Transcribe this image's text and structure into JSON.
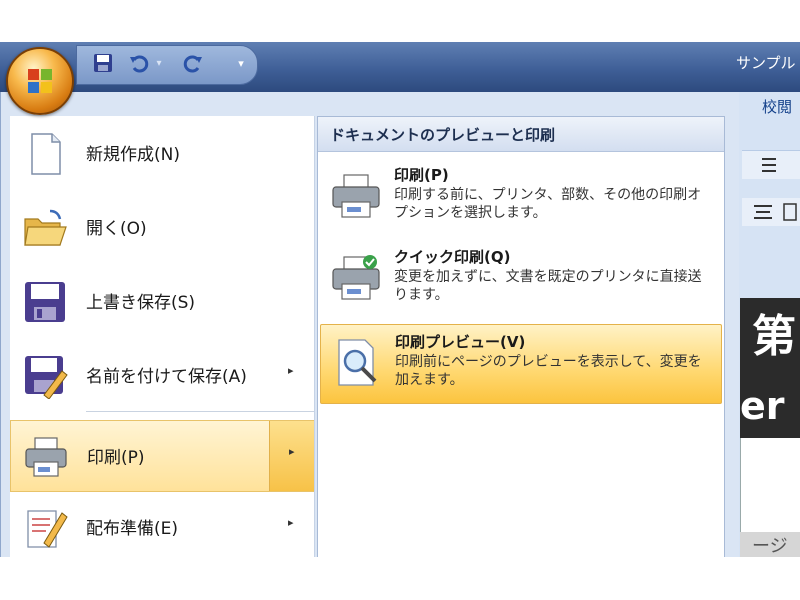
{
  "title_bar": {
    "title": "サンプル"
  },
  "ribbon": {
    "tab_partial": "校閲"
  },
  "document": {
    "heading_partial": "第",
    "latin_partial": "er",
    "bottom_partial": "ージ"
  },
  "menu": {
    "items": [
      {
        "label": "新規作成(N)",
        "icon": "new-document-icon",
        "has_submenu": false
      },
      {
        "label": "開く(O)",
        "icon": "open-folder-icon",
        "has_submenu": false
      },
      {
        "label": "上書き保存(S)",
        "icon": "save-icon",
        "has_submenu": false
      },
      {
        "label": "名前を付けて保存(A)",
        "icon": "save-as-icon",
        "has_submenu": true
      },
      {
        "label": "印刷(P)",
        "icon": "printer-icon",
        "has_submenu": true,
        "highlighted": true
      },
      {
        "label": "配布準備(E)",
        "icon": "prepare-icon",
        "has_submenu": true
      }
    ],
    "submenu_arrow": "▸"
  },
  "submenu": {
    "title": "ドキュメントのプレビューと印刷",
    "items": [
      {
        "title": "印刷(P)",
        "description": "印刷する前に、プリンタ、部数、その他の印刷オプションを選択します。",
        "icon": "printer-icon"
      },
      {
        "title": "クイック印刷(Q)",
        "description": "変更を加えずに、文書を既定のプリンタに直接送ります。",
        "icon": "quick-print-icon"
      },
      {
        "title": "印刷プレビュー(V)",
        "description": "印刷前にページのプレビューを表示して、変更を加えます。",
        "icon": "print-preview-icon",
        "highlighted": true
      }
    ]
  },
  "colors": {
    "title_bar": "#3f5f97",
    "menu_background": "#dae5f4",
    "highlight": "#ffd870",
    "orb": "#f8b94c"
  }
}
